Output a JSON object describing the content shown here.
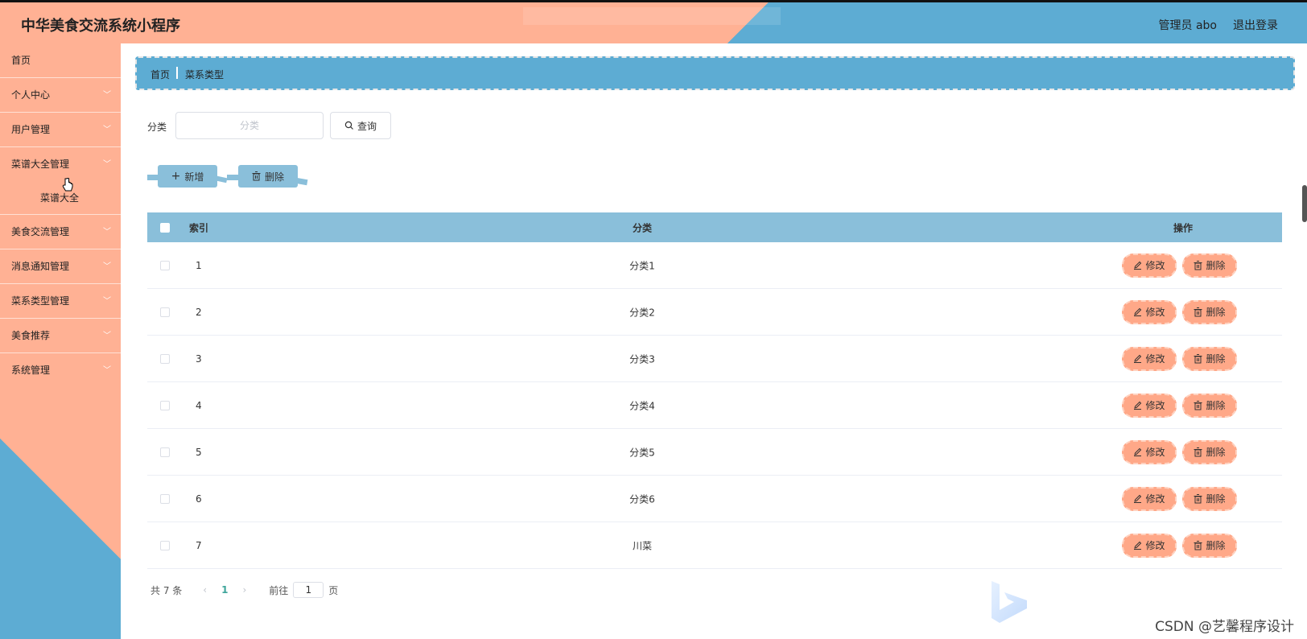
{
  "header": {
    "title": "中华美食交流系统小程序",
    "user": "管理员 abo",
    "logout": "退出登录"
  },
  "sidebar": {
    "items": [
      {
        "label": "首页",
        "has_arrow": false
      },
      {
        "label": "个人中心",
        "has_arrow": true
      },
      {
        "label": "用户管理",
        "has_arrow": true
      },
      {
        "label": "菜谱大全管理",
        "has_arrow": true
      },
      {
        "label": "美食交流管理",
        "has_arrow": true
      },
      {
        "label": "消息通知管理",
        "has_arrow": true
      },
      {
        "label": "菜系类型管理",
        "has_arrow": true
      },
      {
        "label": "美食推荐",
        "has_arrow": true
      },
      {
        "label": "系统管理",
        "has_arrow": true
      }
    ],
    "sub_item": "菜谱大全"
  },
  "breadcrumb": {
    "home": "首页",
    "current": "菜系类型"
  },
  "search": {
    "label": "分类",
    "placeholder": "分类",
    "button": "查询"
  },
  "actions": {
    "add": "新增",
    "delete": "删除"
  },
  "table": {
    "headers": {
      "index": "索引",
      "category": "分类",
      "operation": "操作"
    },
    "rows": [
      {
        "index": "1",
        "category": "分类1"
      },
      {
        "index": "2",
        "category": "分类2"
      },
      {
        "index": "3",
        "category": "分类3"
      },
      {
        "index": "4",
        "category": "分类4"
      },
      {
        "index": "5",
        "category": "分类5"
      },
      {
        "index": "6",
        "category": "分类6"
      },
      {
        "index": "7",
        "category": "川菜"
      }
    ],
    "edit_label": "修改",
    "delete_label": "删除"
  },
  "pagination": {
    "total": "共 7 条",
    "current_page": "1",
    "goto": "前往",
    "jump_value": "1",
    "unit": "页"
  },
  "watermark": "CSDN @艺馨程序设计",
  "colors": {
    "peach": "#ffb194",
    "blue": "#5dacd3",
    "light_blue": "#8abfda",
    "row_button": "#ffa888"
  }
}
